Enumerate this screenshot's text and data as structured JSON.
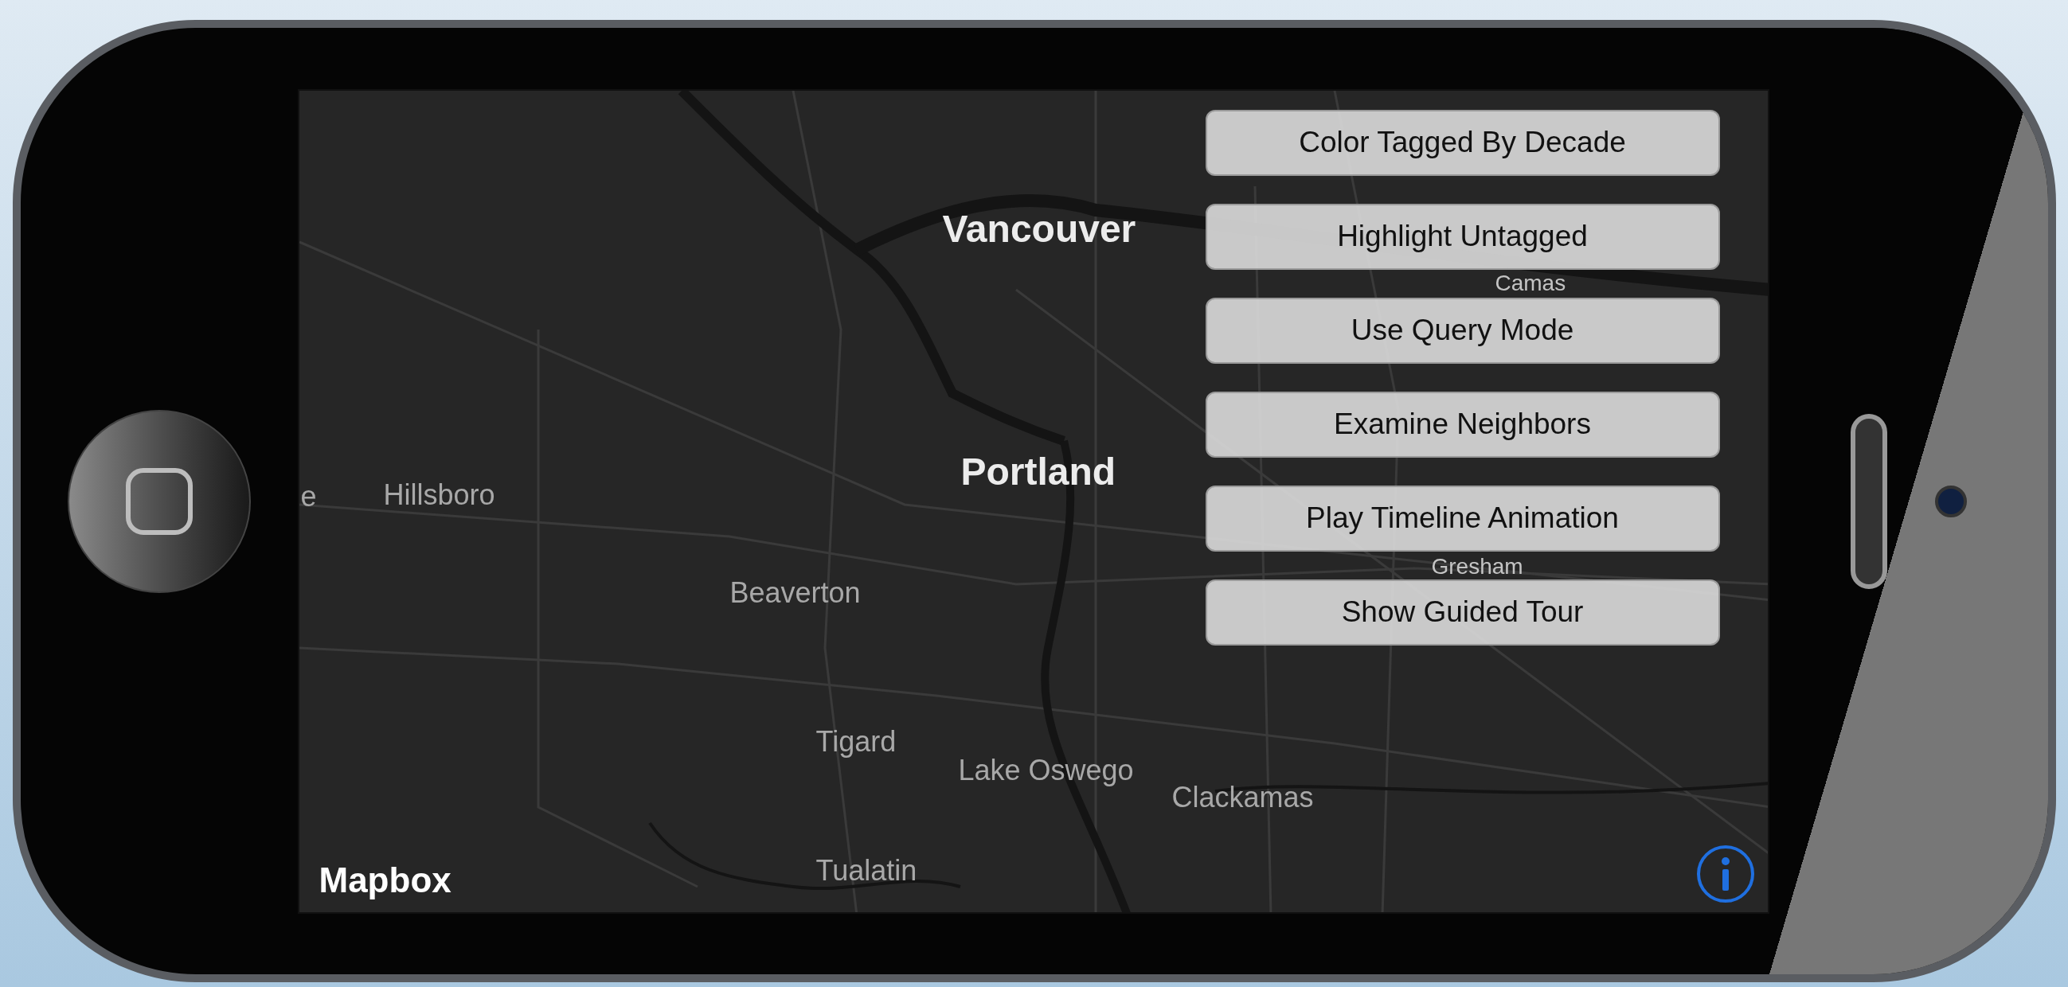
{
  "map": {
    "labels": [
      {
        "text": "Vancouver",
        "kind": "city"
      },
      {
        "text": "Portland",
        "kind": "city"
      },
      {
        "text": "e",
        "kind": "town"
      },
      {
        "text": "Hillsboro",
        "kind": "town"
      },
      {
        "text": "Beaverton",
        "kind": "town"
      },
      {
        "text": "Tigard",
        "kind": "town"
      },
      {
        "text": "Lake Oswego",
        "kind": "town"
      },
      {
        "text": "Clackamas",
        "kind": "town"
      },
      {
        "text": "Tualatin",
        "kind": "town"
      },
      {
        "text": "Camas",
        "kind": "faint"
      },
      {
        "text": "Gresham",
        "kind": "faint"
      }
    ],
    "attribution": "Mapbox"
  },
  "buttons": [
    "Color Tagged By Decade",
    "Highlight Untagged",
    "Use Query Mode",
    "Examine Neighbors",
    "Play Timeline Animation",
    "Show Guided Tour"
  ]
}
